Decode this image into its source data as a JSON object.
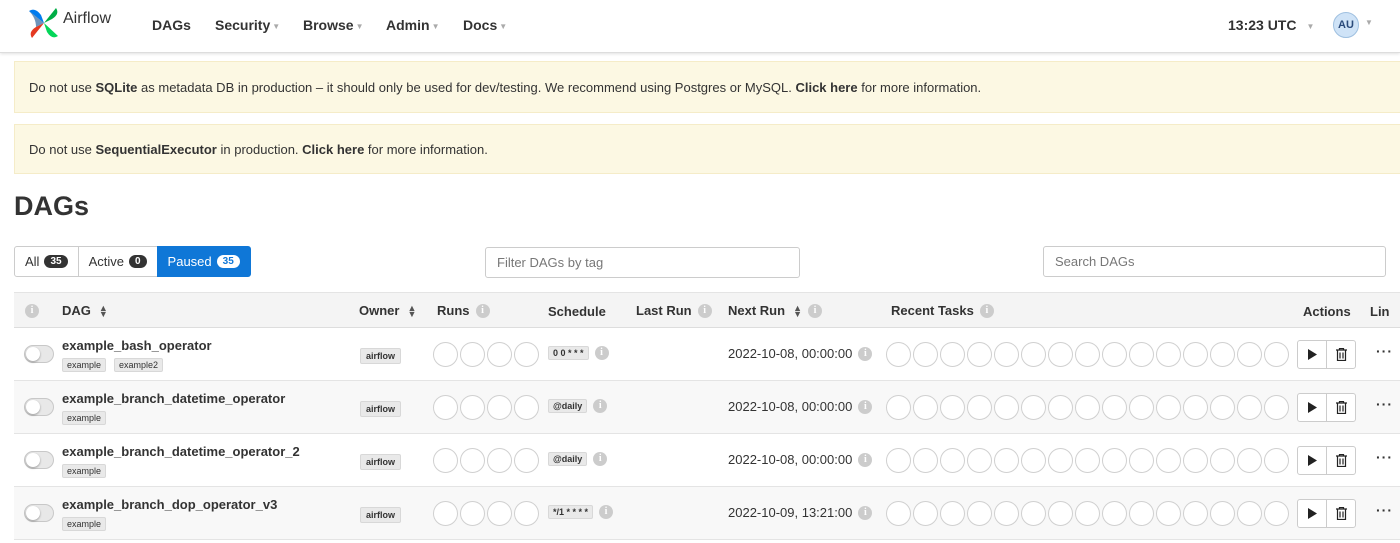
{
  "navbar": {
    "brand": "Airflow",
    "items": [
      {
        "label": "DAGs",
        "dropdown": false
      },
      {
        "label": "Security",
        "dropdown": true
      },
      {
        "label": "Browse",
        "dropdown": true
      },
      {
        "label": "Admin",
        "dropdown": true
      },
      {
        "label": "Docs",
        "dropdown": true
      }
    ],
    "time": "13:23 UTC",
    "user_initials": "AU"
  },
  "alerts": [
    {
      "parts": [
        {
          "text": "Do not use ",
          "bold": false
        },
        {
          "text": "SQLite",
          "bold": true
        },
        {
          "text": " as metadata DB in production – it should only be used for dev/testing. We recommend using Postgres or MySQL. ",
          "bold": false
        },
        {
          "text": "Click here",
          "bold": true
        },
        {
          "text": " for more information.",
          "bold": false
        }
      ]
    },
    {
      "parts": [
        {
          "text": "Do not use ",
          "bold": false
        },
        {
          "text": "SequentialExecutor",
          "bold": true
        },
        {
          "text": " in production. ",
          "bold": false
        },
        {
          "text": "Click here",
          "bold": true
        },
        {
          "text": " for more information.",
          "bold": false
        }
      ]
    }
  ],
  "page_title": "DAGs",
  "filters": [
    {
      "label": "All",
      "count": "35",
      "active": false
    },
    {
      "label": "Active",
      "count": "0",
      "active": false
    },
    {
      "label": "Paused",
      "count": "35",
      "active": true
    }
  ],
  "tag_filter_placeholder": "Filter DAGs by tag",
  "search_placeholder": "Search DAGs",
  "columns": {
    "dag": "DAG",
    "owner": "Owner",
    "runs": "Runs",
    "schedule": "Schedule",
    "last_run": "Last Run",
    "next_run": "Next Run",
    "recent_tasks": "Recent Tasks",
    "actions": "Actions",
    "links": "Lin"
  },
  "dags": [
    {
      "name": "example_bash_operator",
      "tags": [
        "example",
        "example2"
      ],
      "owner": "airflow",
      "schedule": "0 0 * * *",
      "next_run": "2022-10-08, 00:00:00"
    },
    {
      "name": "example_branch_datetime_operator",
      "tags": [
        "example"
      ],
      "owner": "airflow",
      "schedule": "@daily",
      "next_run": "2022-10-08, 00:00:00"
    },
    {
      "name": "example_branch_datetime_operator_2",
      "tags": [
        "example"
      ],
      "owner": "airflow",
      "schedule": "@daily",
      "next_run": "2022-10-08, 00:00:00"
    },
    {
      "name": "example_branch_dop_operator_v3",
      "tags": [
        "example"
      ],
      "owner": "airflow",
      "schedule": "*/1 * * * *",
      "next_run": "2022-10-09, 13:21:00"
    }
  ],
  "colors": {
    "accent": "#0f77d7",
    "alert_bg": "#fcf8e3",
    "header_bg": "#f4f4f4"
  }
}
